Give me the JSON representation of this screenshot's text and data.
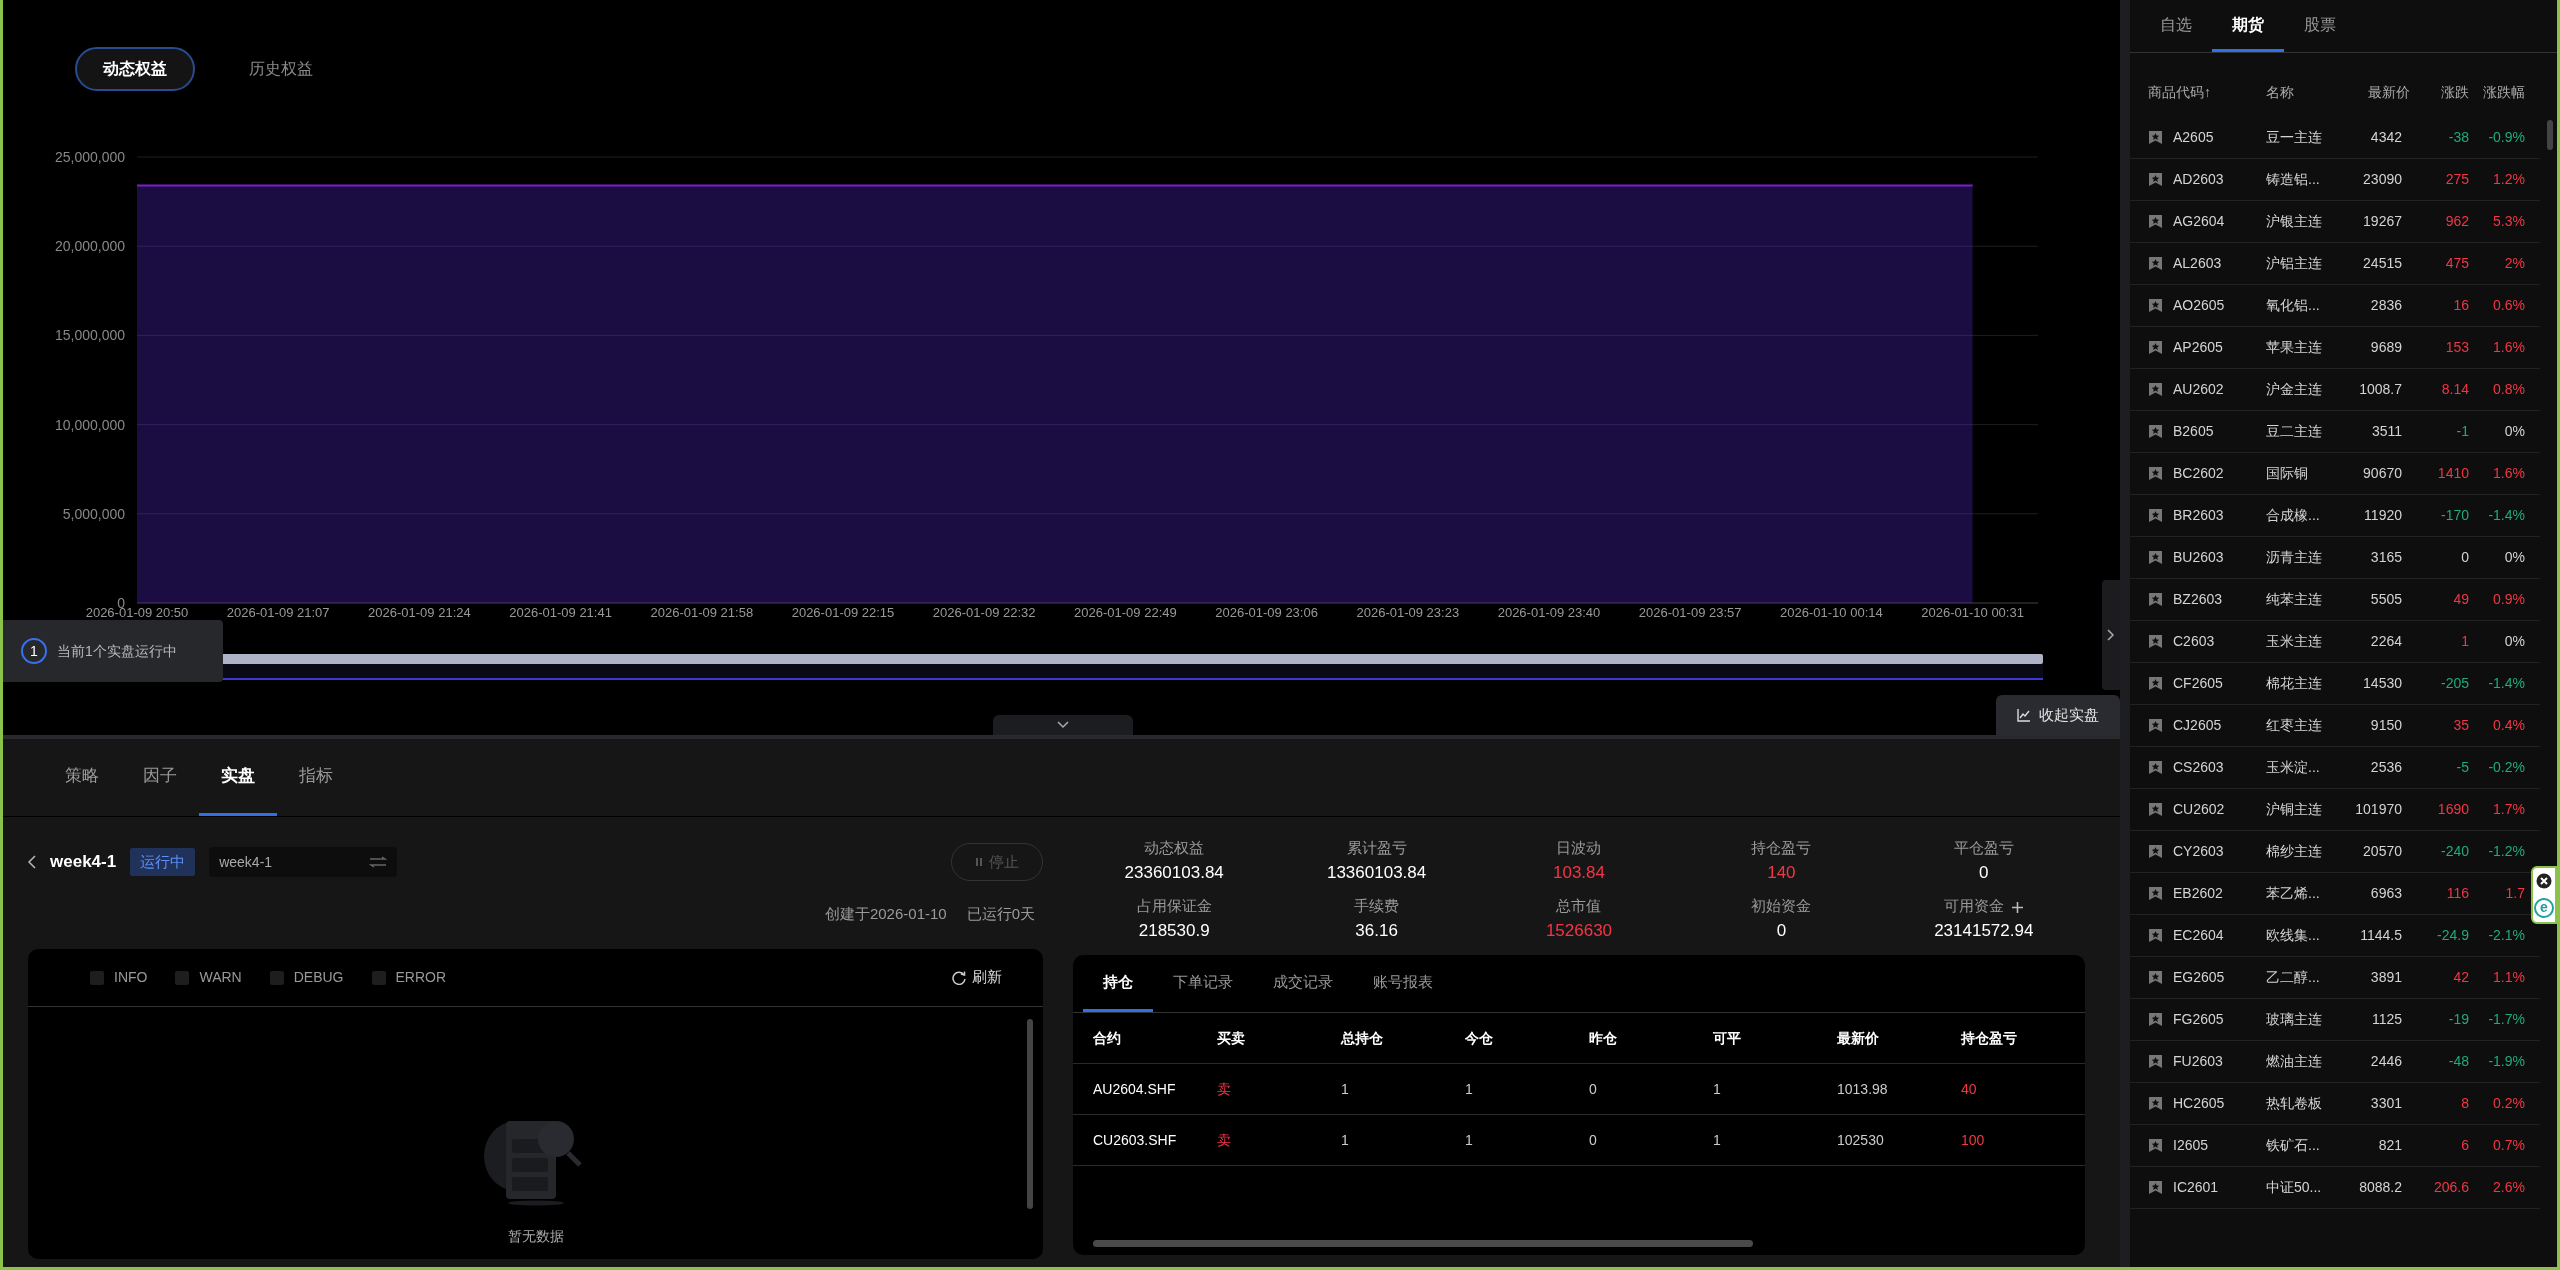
{
  "chart_tabs": [
    {
      "label": "动态权益",
      "selected": true
    },
    {
      "label": "历史权益",
      "selected": false
    }
  ],
  "equity_chart": {
    "chart_data": {
      "type": "area",
      "categories": [
        "2026-01-09 20:50",
        "2026-01-09 21:07",
        "2026-01-09 21:24",
        "2026-01-09 21:41",
        "2026-01-09 21:58",
        "2026-01-09 22:15",
        "2026-01-09 22:32",
        "2026-01-09 22:49",
        "2026-01-09 23:06",
        "2026-01-09 23:23",
        "2026-01-09 23:40",
        "2026-01-09 23:57",
        "2026-01-10 00:14",
        "2026-01-10 00:31"
      ],
      "values": [
        23400000,
        23400000,
        23400000,
        23400000,
        23400000,
        23400000,
        23400000,
        23400000,
        23400000,
        23400000,
        23400000,
        23400000,
        23400000,
        23400000
      ],
      "ylim": [
        0,
        25000000
      ],
      "grid": true,
      "yticks": [
        {
          "value": 0,
          "label": "0"
        },
        {
          "value": 5000000,
          "label": "5,000,000"
        },
        {
          "value": 10000000,
          "label": "10,000,000"
        },
        {
          "value": 15000000,
          "label": "15,000,000"
        },
        {
          "value": 20000000,
          "label": "20,000,000"
        },
        {
          "value": 25000000,
          "label": "25,000,000"
        }
      ]
    }
  },
  "zoom_slider": {
    "level": 1
  },
  "running_notice": {
    "count": "1",
    "text": "当前1个实盘运行中"
  },
  "collapse_button": {
    "label": "收起实盘"
  },
  "bottom_tabs": [
    {
      "label": "策略",
      "selected": false
    },
    {
      "label": "因子",
      "selected": false
    },
    {
      "label": "实盘",
      "selected": true
    },
    {
      "label": "指标",
      "selected": false
    }
  ],
  "live": {
    "name": "week4-1",
    "status": "运行中",
    "selector_value": "week4-1",
    "stop_button": {
      "label": "停止",
      "disabled": true
    },
    "created": "创建于2026-01-10",
    "running_days": "已运行0天"
  },
  "log_panel": {
    "filters": [
      {
        "label": "INFO",
        "checked": false
      },
      {
        "label": "WARN",
        "checked": false
      },
      {
        "label": "DEBUG",
        "checked": false
      },
      {
        "label": "ERROR",
        "checked": false
      }
    ],
    "refresh": "刷新",
    "empty_text": "暂无数据"
  },
  "stats": [
    {
      "label": "动态权益",
      "value": "23360103.84",
      "color": "#ffffff",
      "kind": "plain"
    },
    {
      "label": "累计盈亏",
      "value": "13360103.84",
      "color": "#ffffff",
      "kind": "plain"
    },
    {
      "label": "日波动",
      "value": "103.84",
      "color": "#f23645",
      "kind": "plain"
    },
    {
      "label": "持仓盈亏",
      "value": "140",
      "color": "#f23645",
      "kind": "plain"
    },
    {
      "label": "平仓盈亏",
      "value": "0",
      "color": "#ffffff",
      "kind": "plain"
    },
    {
      "label": "占用保证金",
      "value": "218530.9",
      "color": "#ffffff",
      "kind": "plain"
    },
    {
      "label": "手续费",
      "value": "36.16",
      "color": "#ffffff",
      "kind": "plain"
    },
    {
      "label": "总市值",
      "value": "1526630",
      "color": "#f23645",
      "kind": "plain"
    },
    {
      "label": "初始资金",
      "value": "0",
      "color": "#ffffff",
      "kind": "plain"
    },
    {
      "label": "可用资金",
      "value": "23141572.94",
      "color": "#ffffff",
      "kind": "addable"
    }
  ],
  "positions": {
    "tabs": [
      {
        "label": "持仓",
        "selected": true
      },
      {
        "label": "下单记录",
        "selected": false
      },
      {
        "label": "成交记录",
        "selected": false
      },
      {
        "label": "账号报表",
        "selected": false
      }
    ],
    "columns": [
      "合约",
      "买卖",
      "总持仓",
      "今仓",
      "昨仓",
      "可平",
      "最新价",
      "持仓盈亏"
    ],
    "rows": [
      {
        "contract": "AU2604.SHF",
        "side": {
          "text": "卖",
          "color": "#f23645"
        },
        "total": "1",
        "today": "1",
        "yesterday": "0",
        "closable": "1",
        "last": "1013.98",
        "pnl": {
          "text": "40",
          "color": "#f23645"
        }
      },
      {
        "contract": "CU2603.SHF",
        "side": {
          "text": "卖",
          "color": "#f23645"
        },
        "total": "1",
        "today": "1",
        "yesterday": "0",
        "closable": "1",
        "last": "102530",
        "pnl": {
          "text": "100",
          "color": "#f23645"
        }
      }
    ]
  },
  "watchlist": {
    "tabs": [
      {
        "label": "自选",
        "selected": false
      },
      {
        "label": "期货",
        "selected": true
      },
      {
        "label": "股票",
        "selected": false
      }
    ],
    "columns": [
      "商品代码↑",
      "名称",
      "最新价",
      "涨跌",
      "涨跌幅"
    ],
    "rows": [
      {
        "code": "A2605",
        "name": "豆一主连",
        "price": "4342",
        "change": {
          "text": "-38",
          "color": "#1fab7d"
        },
        "pct": {
          "text": "-0.9%",
          "color": "#1fab7d"
        }
      },
      {
        "code": "AD2603",
        "name": "铸造铝...",
        "price": "23090",
        "change": {
          "text": "275",
          "color": "#f23645"
        },
        "pct": {
          "text": "1.2%",
          "color": "#f23645"
        }
      },
      {
        "code": "AG2604",
        "name": "沪银主连",
        "price": "19267",
        "change": {
          "text": "962",
          "color": "#f23645"
        },
        "pct": {
          "text": "5.3%",
          "color": "#f23645"
        }
      },
      {
        "code": "AL2603",
        "name": "沪铝主连",
        "price": "24515",
        "change": {
          "text": "475",
          "color": "#f23645"
        },
        "pct": {
          "text": "2%",
          "color": "#f23645"
        }
      },
      {
        "code": "AO2605",
        "name": "氧化铝...",
        "price": "2836",
        "change": {
          "text": "16",
          "color": "#f23645"
        },
        "pct": {
          "text": "0.6%",
          "color": "#f23645"
        }
      },
      {
        "code": "AP2605",
        "name": "苹果主连",
        "price": "9689",
        "change": {
          "text": "153",
          "color": "#f23645"
        },
        "pct": {
          "text": "1.6%",
          "color": "#f23645"
        }
      },
      {
        "code": "AU2602",
        "name": "沪金主连",
        "price": "1008.7",
        "change": {
          "text": "8.14",
          "color": "#f23645"
        },
        "pct": {
          "text": "0.8%",
          "color": "#f23645"
        }
      },
      {
        "code": "B2605",
        "name": "豆二主连",
        "price": "3511",
        "change": {
          "text": "-1",
          "color": "#1fab7d"
        },
        "pct": {
          "text": "0%",
          "color": "#d4d4d4"
        }
      },
      {
        "code": "BC2602",
        "name": "国际铜",
        "price": "90670",
        "change": {
          "text": "1410",
          "color": "#f23645"
        },
        "pct": {
          "text": "1.6%",
          "color": "#f23645"
        }
      },
      {
        "code": "BR2603",
        "name": "合成橡...",
        "price": "11920",
        "change": {
          "text": "-170",
          "color": "#1fab7d"
        },
        "pct": {
          "text": "-1.4%",
          "color": "#1fab7d"
        }
      },
      {
        "code": "BU2603",
        "name": "沥青主连",
        "price": "3165",
        "change": {
          "text": "0",
          "color": "#d4d4d4"
        },
        "pct": {
          "text": "0%",
          "color": "#d4d4d4"
        }
      },
      {
        "code": "BZ2603",
        "name": "纯苯主连",
        "price": "5505",
        "change": {
          "text": "49",
          "color": "#f23645"
        },
        "pct": {
          "text": "0.9%",
          "color": "#f23645"
        }
      },
      {
        "code": "C2603",
        "name": "玉米主连",
        "price": "2264",
        "change": {
          "text": "1",
          "color": "#f23645"
        },
        "pct": {
          "text": "0%",
          "color": "#d4d4d4"
        }
      },
      {
        "code": "CF2605",
        "name": "棉花主连",
        "price": "14530",
        "change": {
          "text": "-205",
          "color": "#1fab7d"
        },
        "pct": {
          "text": "-1.4%",
          "color": "#1fab7d"
        }
      },
      {
        "code": "CJ2605",
        "name": "红枣主连",
        "price": "9150",
        "change": {
          "text": "35",
          "color": "#f23645"
        },
        "pct": {
          "text": "0.4%",
          "color": "#f23645"
        }
      },
      {
        "code": "CS2603",
        "name": "玉米淀...",
        "price": "2536",
        "change": {
          "text": "-5",
          "color": "#1fab7d"
        },
        "pct": {
          "text": "-0.2%",
          "color": "#1fab7d"
        }
      },
      {
        "code": "CU2602",
        "name": "沪铜主连",
        "price": "101970",
        "change": {
          "text": "1690",
          "color": "#f23645"
        },
        "pct": {
          "text": "1.7%",
          "color": "#f23645"
        }
      },
      {
        "code": "CY2603",
        "name": "棉纱主连",
        "price": "20570",
        "change": {
          "text": "-240",
          "color": "#1fab7d"
        },
        "pct": {
          "text": "-1.2%",
          "color": "#1fab7d"
        }
      },
      {
        "code": "EB2602",
        "name": "苯乙烯...",
        "price": "6963",
        "change": {
          "text": "116",
          "color": "#f23645"
        },
        "pct": {
          "text": "1.7",
          "color": "#f23645"
        }
      },
      {
        "code": "EC2604",
        "name": "欧线集...",
        "price": "1144.5",
        "change": {
          "text": "-24.9",
          "color": "#1fab7d"
        },
        "pct": {
          "text": "-2.1%",
          "color": "#1fab7d"
        }
      },
      {
        "code": "EG2605",
        "name": "乙二醇...",
        "price": "3891",
        "change": {
          "text": "42",
          "color": "#f23645"
        },
        "pct": {
          "text": "1.1%",
          "color": "#f23645"
        }
      },
      {
        "code": "FG2605",
        "name": "玻璃主连",
        "price": "1125",
        "change": {
          "text": "-19",
          "color": "#1fab7d"
        },
        "pct": {
          "text": "-1.7%",
          "color": "#1fab7d"
        }
      },
      {
        "code": "FU2603",
        "name": "燃油主连",
        "price": "2446",
        "change": {
          "text": "-48",
          "color": "#1fab7d"
        },
        "pct": {
          "text": "-1.9%",
          "color": "#1fab7d"
        }
      },
      {
        "code": "HC2605",
        "name": "热轧卷板",
        "price": "3301",
        "change": {
          "text": "8",
          "color": "#f23645"
        },
        "pct": {
          "text": "0.2%",
          "color": "#f23645"
        }
      },
      {
        "code": "I2605",
        "name": "铁矿石...",
        "price": "821",
        "change": {
          "text": "6",
          "color": "#f23645"
        },
        "pct": {
          "text": "0.7%",
          "color": "#f23645"
        }
      },
      {
        "code": "IC2601",
        "name": "中证50...",
        "price": "8088.2",
        "change": {
          "text": "206.6",
          "color": "#f23645"
        },
        "pct": {
          "text": "2.6%",
          "color": "#f23645"
        }
      }
    ]
  },
  "extension_widget": {
    "label": "e"
  }
}
